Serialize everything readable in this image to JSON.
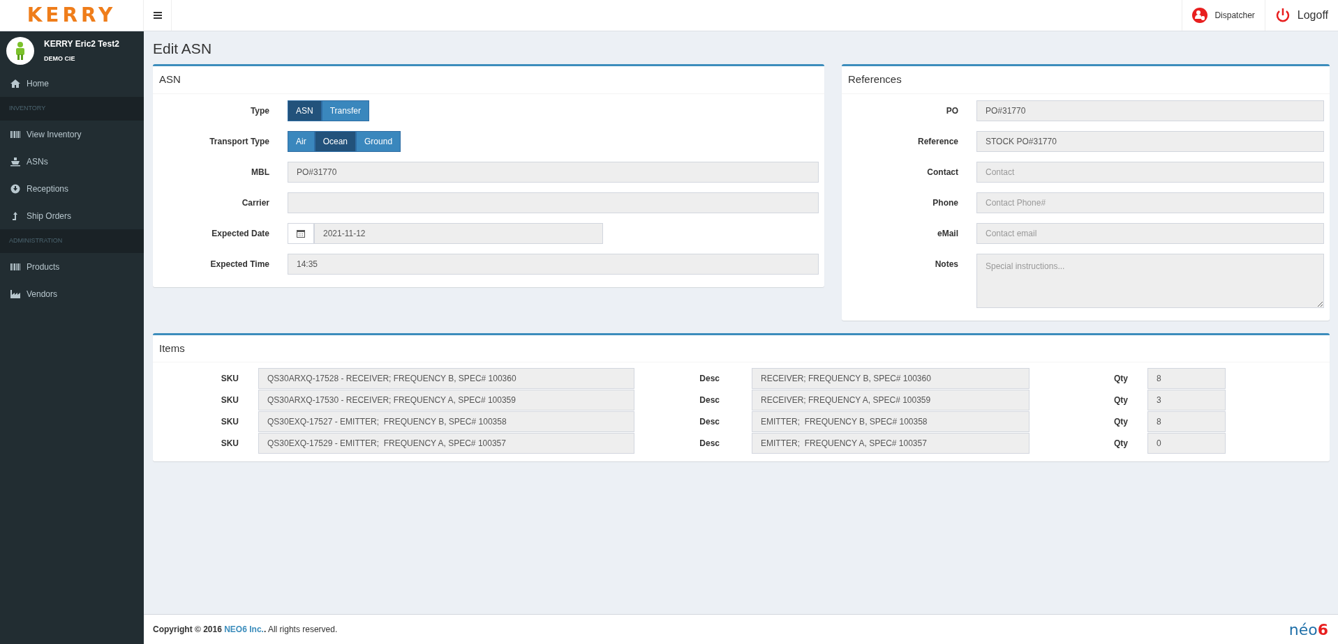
{
  "brand": {
    "logo": "KERRY"
  },
  "topbar": {
    "dispatcher": "Dispatcher",
    "logoff": "Logoff"
  },
  "user": {
    "name": "KERRY Eric2 Test2",
    "company": "DEMO CIE"
  },
  "sidebar": {
    "items": [
      {
        "kind": "link",
        "label": "Home"
      },
      {
        "kind": "header",
        "label": "INVENTORY"
      },
      {
        "kind": "link",
        "label": "View Inventory"
      },
      {
        "kind": "link",
        "label": "ASNs"
      },
      {
        "kind": "link",
        "label": "Receptions"
      },
      {
        "kind": "link",
        "label": "Ship Orders"
      },
      {
        "kind": "header",
        "label": "ADMINISTRATION"
      },
      {
        "kind": "link",
        "label": "Products"
      },
      {
        "kind": "link",
        "label": "Vendors"
      }
    ]
  },
  "page_title": "Edit ASN",
  "asn": {
    "title": "ASN",
    "fields": [
      {
        "kind": "toggle",
        "label": "Type",
        "options": [
          {
            "label": "ASN",
            "selected": true
          },
          {
            "label": "Transfer",
            "selected": false
          }
        ]
      },
      {
        "kind": "toggle",
        "label": "Transport Type",
        "options": [
          {
            "label": "Air",
            "selected": false
          },
          {
            "label": "Ocean",
            "selected": true
          },
          {
            "label": "Ground",
            "selected": false
          }
        ]
      },
      {
        "kind": "text",
        "label": "MBL",
        "value": "PO#31770"
      },
      {
        "kind": "text",
        "label": "Carrier"
      },
      {
        "kind": "date",
        "label": "Expected Date",
        "value": "2021-11-12"
      },
      {
        "kind": "text",
        "label": "Expected Time",
        "value": "14:35"
      }
    ]
  },
  "references": {
    "title": "References",
    "fields": [
      {
        "kind": "text",
        "label": "PO",
        "value": "PO#31770"
      },
      {
        "kind": "text",
        "label": "Reference",
        "value": "STOCK PO#31770"
      },
      {
        "kind": "text",
        "label": "Contact",
        "placeholder": "Contact"
      },
      {
        "kind": "text",
        "label": "Phone",
        "placeholder": "Contact Phone#"
      },
      {
        "kind": "text",
        "label": "eMail",
        "placeholder": "Contact email"
      },
      {
        "kind": "textarea",
        "label": "Notes",
        "placeholder": "Special instructions..."
      }
    ]
  },
  "items": {
    "title": "Items",
    "rows": [
      {
        "sku_label": "SKU",
        "sku": "QS30ARXQ-17528 - RECEIVER; FREQUENCY B, SPEC# 100360",
        "desc_label": "Desc",
        "desc": "RECEIVER; FREQUENCY B, SPEC# 100360",
        "qty_label": "Qty",
        "qty": "8"
      },
      {
        "sku_label": "SKU",
        "sku": "QS30ARXQ-17530 - RECEIVER; FREQUENCY A, SPEC# 100359",
        "desc_label": "Desc",
        "desc": "RECEIVER; FREQUENCY A, SPEC# 100359",
        "qty_label": "Qty",
        "qty": "3"
      },
      {
        "sku_label": "SKU",
        "sku": "QS30EXQ-17527 - EMITTER;  FREQUENCY B, SPEC# 100358",
        "desc_label": "Desc",
        "desc": "EMITTER;  FREQUENCY B, SPEC# 100358",
        "qty_label": "Qty",
        "qty": "8"
      },
      {
        "sku_label": "SKU",
        "sku": "QS30EXQ-17529 - EMITTER;  FREQUENCY A, SPEC# 100357",
        "desc_label": "Desc",
        "desc": "EMITTER;  FREQUENCY A, SPEC# 100357",
        "qty_label": "Qty",
        "qty": "0"
      }
    ]
  },
  "footer": {
    "prefix": "Copyright © 2016 ",
    "link": "NEO6 Inc.",
    "suffix": "**.** All rights reserved.",
    "logo_main": "néo",
    "logo_accent": "6"
  }
}
